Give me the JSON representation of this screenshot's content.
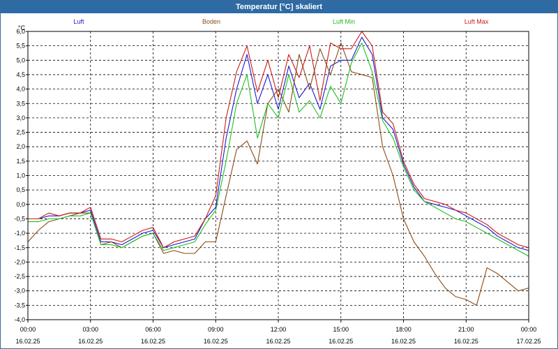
{
  "window": {
    "title": "Temperatur [°C] skaliert"
  },
  "chart_data": {
    "type": "line",
    "title": "Temperatur [°C] skaliert",
    "ylabel": "°C",
    "ylim": [
      -4.0,
      6.0
    ],
    "ytick_step": 0.5,
    "grid": true,
    "legend": "top",
    "x": [
      "00:00",
      "00:30",
      "01:00",
      "01:30",
      "02:00",
      "02:30",
      "03:00",
      "03:30",
      "04:00",
      "04:30",
      "05:00",
      "05:30",
      "06:00",
      "06:30",
      "07:00",
      "07:30",
      "08:00",
      "08:30",
      "09:00",
      "09:30",
      "10:00",
      "10:30",
      "11:00",
      "11:30",
      "12:00",
      "12:30",
      "13:00",
      "13:30",
      "14:00",
      "14:30",
      "15:00",
      "15:30",
      "16:00",
      "16:30",
      "17:00",
      "17:30",
      "18:00",
      "18:30",
      "19:00",
      "19:30",
      "20:00",
      "20:30",
      "21:00",
      "21:30",
      "22:00",
      "22:30",
      "23:00",
      "23:30",
      "00:00"
    ],
    "xticks": [
      {
        "time": "00:00",
        "date": "16.02.25"
      },
      {
        "time": "03:00",
        "date": "16.02.25"
      },
      {
        "time": "06:00",
        "date": "16.02.25"
      },
      {
        "time": "09:00",
        "date": "16.02.25"
      },
      {
        "time": "12:00",
        "date": "16.02.25"
      },
      {
        "time": "15:00",
        "date": "16.02.25"
      },
      {
        "time": "18:00",
        "date": "16.02.25"
      },
      {
        "time": "21:00",
        "date": "16.02.25"
      },
      {
        "time": "00:00",
        "date": "17.02.25"
      }
    ],
    "series": [
      {
        "name": "Luft",
        "color": "#1a1acc",
        "values": [
          -0.5,
          -0.5,
          -0.4,
          -0.4,
          -0.3,
          -0.3,
          -0.2,
          -1.3,
          -1.3,
          -1.4,
          -1.2,
          -1.0,
          -0.9,
          -1.5,
          -1.4,
          -1.3,
          -1.2,
          -0.5,
          -0.1,
          2.3,
          4.0,
          5.2,
          3.5,
          4.5,
          3.3,
          4.8,
          3.7,
          4.2,
          3.3,
          4.8,
          5.0,
          5.0,
          5.8,
          5.2,
          3.0,
          2.6,
          1.4,
          0.6,
          0.1,
          0.0,
          -0.1,
          -0.2,
          -0.4,
          -0.6,
          -0.8,
          -1.1,
          -1.3,
          -1.5,
          -1.6
        ]
      },
      {
        "name": "Boden",
        "color": "#8b4a14",
        "values": [
          -1.3,
          -0.9,
          -0.6,
          -0.5,
          -0.4,
          -0.3,
          -0.3,
          -1.4,
          -1.3,
          -1.5,
          -1.3,
          -1.1,
          -1.0,
          -1.7,
          -1.6,
          -1.7,
          -1.7,
          -1.3,
          -1.3,
          0.3,
          1.9,
          2.2,
          1.4,
          3.5,
          4.0,
          3.2,
          5.2,
          4.0,
          5.4,
          4.5,
          5.6,
          4.6,
          4.5,
          4.4,
          2.0,
          1.0,
          -0.5,
          -1.3,
          -1.8,
          -2.4,
          -2.9,
          -3.2,
          -3.3,
          -3.5,
          -2.2,
          -2.4,
          -2.7,
          -3.0,
          -2.9
        ]
      },
      {
        "name": "Luft Min",
        "color": "#1ebe1e",
        "values": [
          -0.6,
          -0.6,
          -0.5,
          -0.5,
          -0.4,
          -0.4,
          -0.3,
          -1.4,
          -1.4,
          -1.5,
          -1.3,
          -1.1,
          -1.0,
          -1.6,
          -1.5,
          -1.4,
          -1.3,
          -0.7,
          -0.2,
          1.5,
          3.5,
          4.5,
          2.3,
          3.5,
          3.0,
          4.5,
          3.2,
          3.6,
          3.0,
          4.1,
          3.5,
          4.9,
          5.6,
          4.6,
          2.9,
          2.3,
          1.3,
          0.5,
          0.1,
          -0.1,
          -0.3,
          -0.5,
          -0.6,
          -0.8,
          -1.0,
          -1.2,
          -1.4,
          -1.6,
          -1.8
        ]
      },
      {
        "name": "Luft Max",
        "color": "#cc1a1a",
        "values": [
          -0.5,
          -0.5,
          -0.3,
          -0.4,
          -0.3,
          -0.3,
          -0.1,
          -1.2,
          -1.2,
          -1.3,
          -1.1,
          -0.9,
          -0.8,
          -1.5,
          -1.3,
          -1.2,
          -1.1,
          -0.5,
          0.3,
          3.0,
          4.6,
          5.5,
          3.9,
          5.0,
          3.7,
          5.2,
          4.4,
          5.5,
          3.6,
          5.6,
          5.4,
          5.4,
          6.0,
          5.5,
          3.2,
          2.8,
          1.5,
          0.7,
          0.2,
          0.1,
          0.0,
          -0.2,
          -0.3,
          -0.5,
          -0.7,
          -1.0,
          -1.2,
          -1.4,
          -1.5
        ]
      }
    ]
  }
}
